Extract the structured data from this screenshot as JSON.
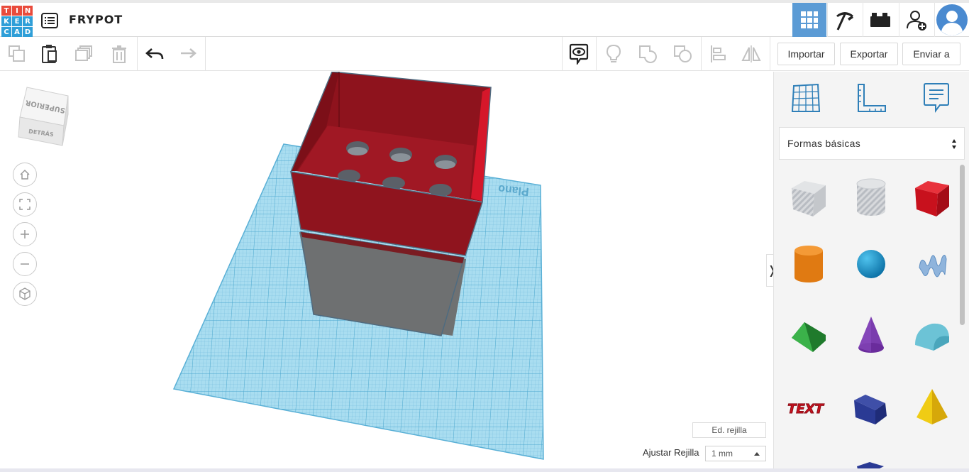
{
  "header": {
    "logo_letters": [
      "T",
      "I",
      "N",
      "K",
      "E",
      "R",
      "C",
      "A",
      "D"
    ],
    "logo_colors": [
      "#e94b3c",
      "#e94b3c",
      "#e94b3c",
      "#2f9fd8",
      "#2f9fd8",
      "#2f9fd8",
      "#2f9fd8",
      "#2f9fd8",
      "#2f9fd8"
    ],
    "design_name": "FRYPOT",
    "icons": [
      "list-icon",
      "grid-view-icon",
      "pickaxe-icon",
      "bricks-icon",
      "add-user-icon",
      "avatar-icon"
    ],
    "accent": "#5b9bd5"
  },
  "toolbar": {
    "icons": [
      "copy-icon",
      "paste-icon",
      "duplicate-icon",
      "delete-icon",
      "undo-icon",
      "redo-icon",
      "notes-visibility-icon",
      "light-bulb-icon",
      "group-icon",
      "ungroup-icon",
      "align-icon",
      "mirror-icon"
    ],
    "import_label": "Importar",
    "export_label": "Exportar",
    "send_label": "Enviar a"
  },
  "viewport": {
    "viewcube_top": "SUPERIOR",
    "viewcube_front": "DETRÁS",
    "workplane_label": "Plano",
    "nav_icons": [
      "home-view-icon",
      "fit-view-icon",
      "zoom-in-icon",
      "zoom-out-icon",
      "perspective-icon"
    ],
    "grid_edit_label": "Ed. rejilla",
    "snap_label": "Ajustar Rejilla",
    "snap_value": "1 mm",
    "workplane_color": "#8fd0ea",
    "box_red": "#9b1520",
    "box_gray": "#6f7172"
  },
  "panel": {
    "tabs": [
      "grid-panel-icon",
      "ruler-icon",
      "notes-icon"
    ],
    "library_label": "Formas básicas",
    "shapes": [
      {
        "name": "box-hole-shape"
      },
      {
        "name": "cylinder-hole-shape"
      },
      {
        "name": "box-shape"
      },
      {
        "name": "cylinder-shape"
      },
      {
        "name": "sphere-shape"
      },
      {
        "name": "scribble-shape"
      },
      {
        "name": "roof-shape"
      },
      {
        "name": "cone-shape"
      },
      {
        "name": "round-roof-shape"
      },
      {
        "name": "text-shape",
        "text": "TEXT"
      },
      {
        "name": "wedge-shape"
      },
      {
        "name": "pyramid-shape"
      }
    ]
  }
}
